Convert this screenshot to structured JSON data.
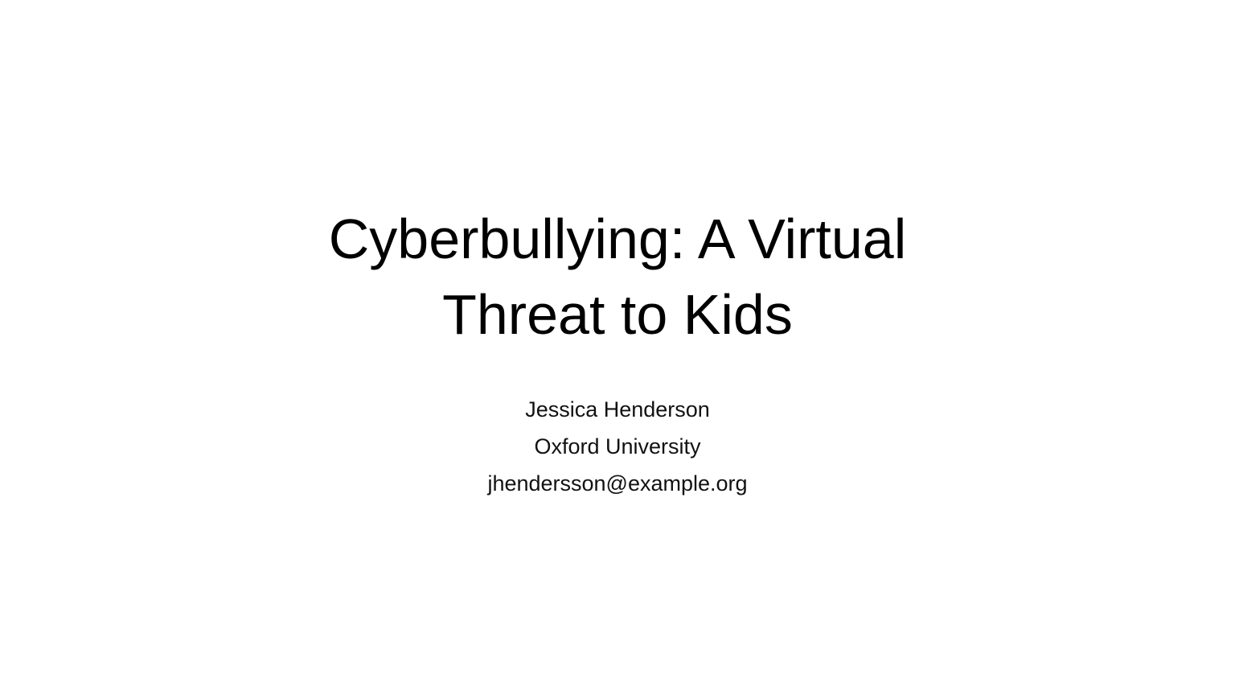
{
  "slide": {
    "title_lines": [
      "Cyberbullying: A Virtual",
      "Threat to Kids"
    ],
    "subtitle_lines": [
      "Jessica Henderson",
      "Oxford University",
      "jhendersson@example.org"
    ]
  },
  "colors": {
    "background": "#ffffff",
    "text": "#000000"
  }
}
